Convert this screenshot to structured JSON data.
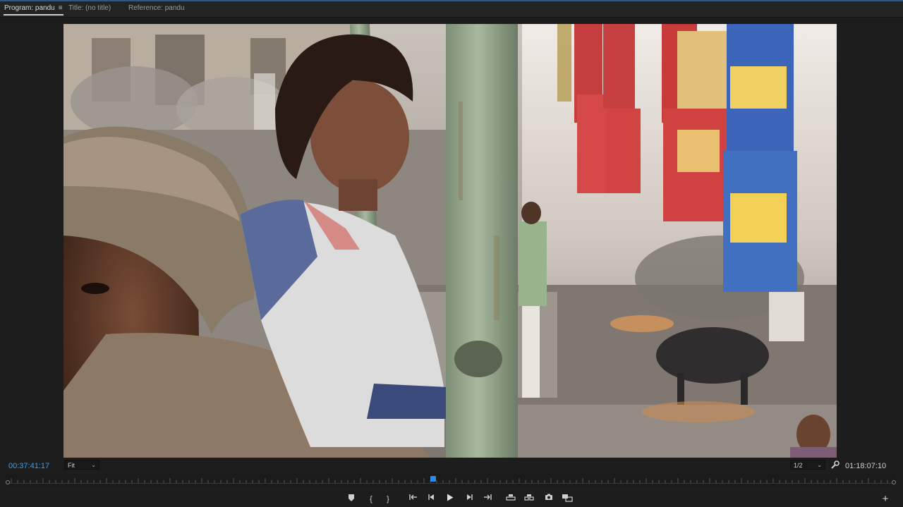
{
  "tabs": [
    {
      "label": "Program: pandu",
      "active": true
    },
    {
      "label": "Title: (no title)",
      "active": false
    },
    {
      "label": "Reference: pandu",
      "active": false
    }
  ],
  "program_menu_icon": "hamburger-menu-icon",
  "timecode": {
    "current": "00:37:41:17",
    "duration": "01:18:07:10"
  },
  "zoom": {
    "selected": "Fit"
  },
  "resolution": {
    "selected": "1/2"
  },
  "playhead_position_fraction": 0.48,
  "controls": [
    "add-marker-icon",
    "mark-in-icon",
    "mark-out-icon",
    "go-to-in-icon",
    "step-back-icon",
    "play-icon",
    "step-forward-icon",
    "go-to-out-icon",
    "lift-icon",
    "extract-icon",
    "export-frame-icon",
    "comparison-view-icon"
  ],
  "colors": {
    "accent": "#2d8ceb",
    "panel": "#1d1d1d",
    "timecode_current": "#3aa0f0"
  }
}
